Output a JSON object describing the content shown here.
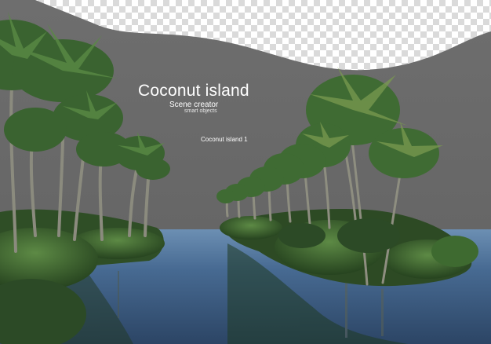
{
  "title": "Coconut island",
  "subtitle": "Scene creator",
  "tagline": "smart objects",
  "label": "Coconut island 1",
  "colors": {
    "backdrop": "#6b6b6b",
    "checker_light": "#ffffff",
    "checker_dark": "#d9d9d9",
    "water": "#3e5f86",
    "palm_foliage": "#3f6b33",
    "palm_trunk": "#8a8a7a",
    "text": "#ffffff"
  }
}
